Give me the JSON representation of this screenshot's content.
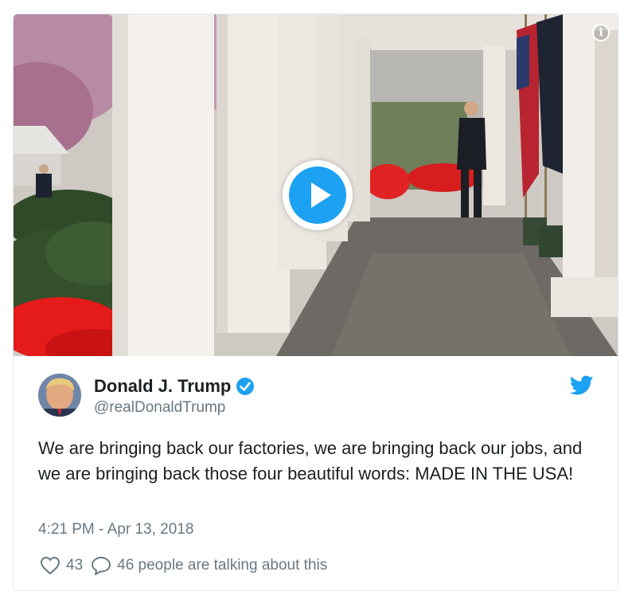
{
  "media": {
    "info_icon": "info-icon",
    "play_icon": "play-icon",
    "colors": {
      "play_blue": "#1da1f2",
      "tulip_red": "#e51a1a",
      "column_white": "#f5f3ef"
    }
  },
  "author": {
    "name": "Donald J. Trump",
    "handle": "@realDonaldTrump",
    "verified_icon": "verified-badge-icon",
    "platform_icon": "twitter-bird-icon"
  },
  "tweet": {
    "text": "We are bringing back our factories, we are bringing back our jobs, and we are bringing back those four beautiful words: MADE IN THE USA!",
    "timestamp": "4:21 PM - Apr 13, 2018"
  },
  "actions": {
    "like_icon": "heart-icon",
    "like_count": "43",
    "reply_icon": "speech-bubble-icon",
    "talking_text": "46 people are talking about this"
  },
  "colors": {
    "accent": "#1da1f2",
    "muted_text": "#697882",
    "border": "#e1e8ed"
  }
}
